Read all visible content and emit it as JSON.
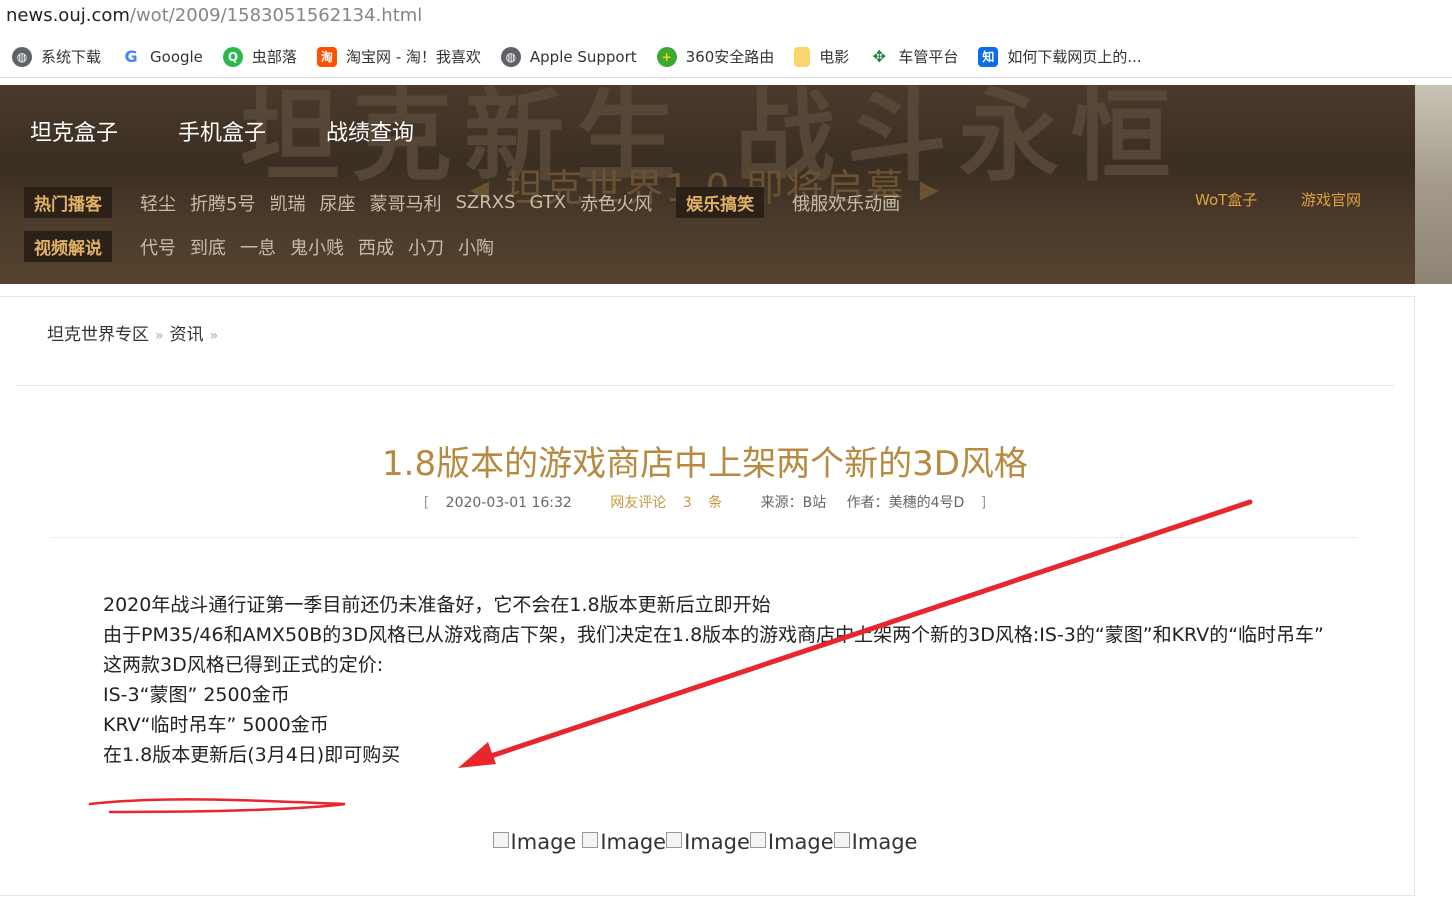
{
  "browser": {
    "url_host": "news.ouj.com",
    "url_path": "/wot/2009/1583051562134.html",
    "bookmarks": [
      {
        "label": "系统下载",
        "icon": "globe-icon",
        "color": "#5f6368"
      },
      {
        "label": "Google",
        "icon": "google-icon",
        "color": "#4285f4"
      },
      {
        "label": "虫部落",
        "icon": "bug-tribe-icon",
        "color": "#2db84d"
      },
      {
        "label": "淘宝网 - 淘！我喜欢",
        "icon": "taobao-icon",
        "color": "#ff5000"
      },
      {
        "label": "Apple Support",
        "icon": "globe-icon",
        "color": "#5f6368"
      },
      {
        "label": "360安全路由",
        "icon": "router-360-icon",
        "color": "#3da935"
      },
      {
        "label": "电影",
        "icon": "folder-icon",
        "color": "#f9d66b"
      },
      {
        "label": "车管平台",
        "icon": "vehicle-platform-icon",
        "color": "#1a7f3c"
      },
      {
        "label": "如何下载网页上的...",
        "icon": "zhihu-icon",
        "color": "#0d6de6"
      }
    ]
  },
  "header": {
    "bg_text": "坦克新生 战斗永恒",
    "bg_subtext": "坦克世界1.0 即将启幕",
    "nav": [
      "坦克盒子",
      "手机盒子",
      "战绩查询"
    ],
    "row1": {
      "tag1": "热门播客",
      "links1": [
        "轻尘",
        "折腾5号",
        "凯瑞",
        "尿座",
        "蒙哥马利",
        "SZRXS",
        "GTX",
        "赤色火风"
      ],
      "tag2": "娱乐搞笑",
      "links2": [
        "俄服欢乐动画"
      ]
    },
    "row2": {
      "tag": "视频解说",
      "links": [
        "代号",
        "到底",
        "一息",
        "鬼小贱",
        "西成",
        "小刀",
        "小陶"
      ]
    },
    "right_links": [
      "WoT盒子",
      "游戏官网"
    ]
  },
  "breadcrumb": [
    "坦克世界专区",
    "资讯"
  ],
  "article": {
    "title": "1.8版本的游戏商店中上架两个新的3D风格",
    "meta": {
      "open": "[",
      "date": "2020-03-01 16:32",
      "comments_label": "网友评论",
      "comments_count": "3",
      "comments_unit": "条",
      "source": "来源：B站",
      "author": "作者：美穗的4号D",
      "close": "]"
    },
    "paragraphs": [
      "2020年战斗通行证第一季目前还仍未准备好，它不会在1.8版本更新后立即开始",
      "由于PM35/46和AMX50B的3D风格已从游戏商店下架，我们决定在1.8版本的游戏商店中上架两个新的3D风格:IS-3的“蒙图”和KRV的“临时吊车”",
      "这两款3D风格已得到正式的定价:",
      "IS-3“蒙图” 2500金币",
      "KRV“临时吊车” 5000金币",
      "在1.8版本更新后(3月4日)即可购买"
    ],
    "image_alts": [
      "Image",
      "Image",
      "Image",
      "Image",
      "Image"
    ]
  },
  "colors": {
    "title": "#b78a3f",
    "annotation": "#e8262b"
  }
}
